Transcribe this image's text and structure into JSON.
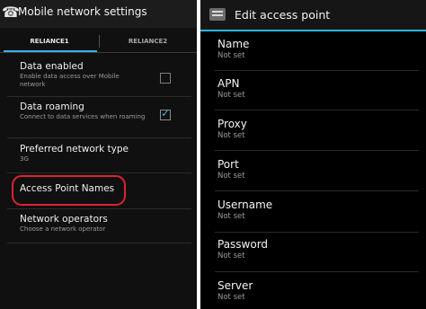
{
  "left": {
    "title": "Mobile network settings",
    "tabs": [
      "RELIANCE1",
      "RELIANCE2"
    ],
    "items": [
      {
        "title": "Data enabled",
        "subtitle": "Enable data access over Mobile network",
        "checked": false
      },
      {
        "title": "Data roaming",
        "subtitle": "Connect to data services when roaming",
        "checked": true
      },
      {
        "title": "Preferred network type",
        "subtitle": "3G"
      },
      {
        "title": "Access Point Names",
        "subtitle": ""
      },
      {
        "title": "Network operators",
        "subtitle": "Choose a network operator"
      }
    ]
  },
  "right": {
    "title": "Edit access point",
    "fields": [
      {
        "title": "Name",
        "value": "Not set"
      },
      {
        "title": "APN",
        "value": "Not set"
      },
      {
        "title": "Proxy",
        "value": "Not set"
      },
      {
        "title": "Port",
        "value": "Not set"
      },
      {
        "title": "Username",
        "value": "Not set"
      },
      {
        "title": "Password",
        "value": "Not set"
      },
      {
        "title": "Server",
        "value": "Not set"
      }
    ]
  },
  "colors": {
    "accent": "#33b5e5",
    "highlight": "#e02030"
  },
  "icons": [
    "phone-icon",
    "settings-icon"
  ]
}
